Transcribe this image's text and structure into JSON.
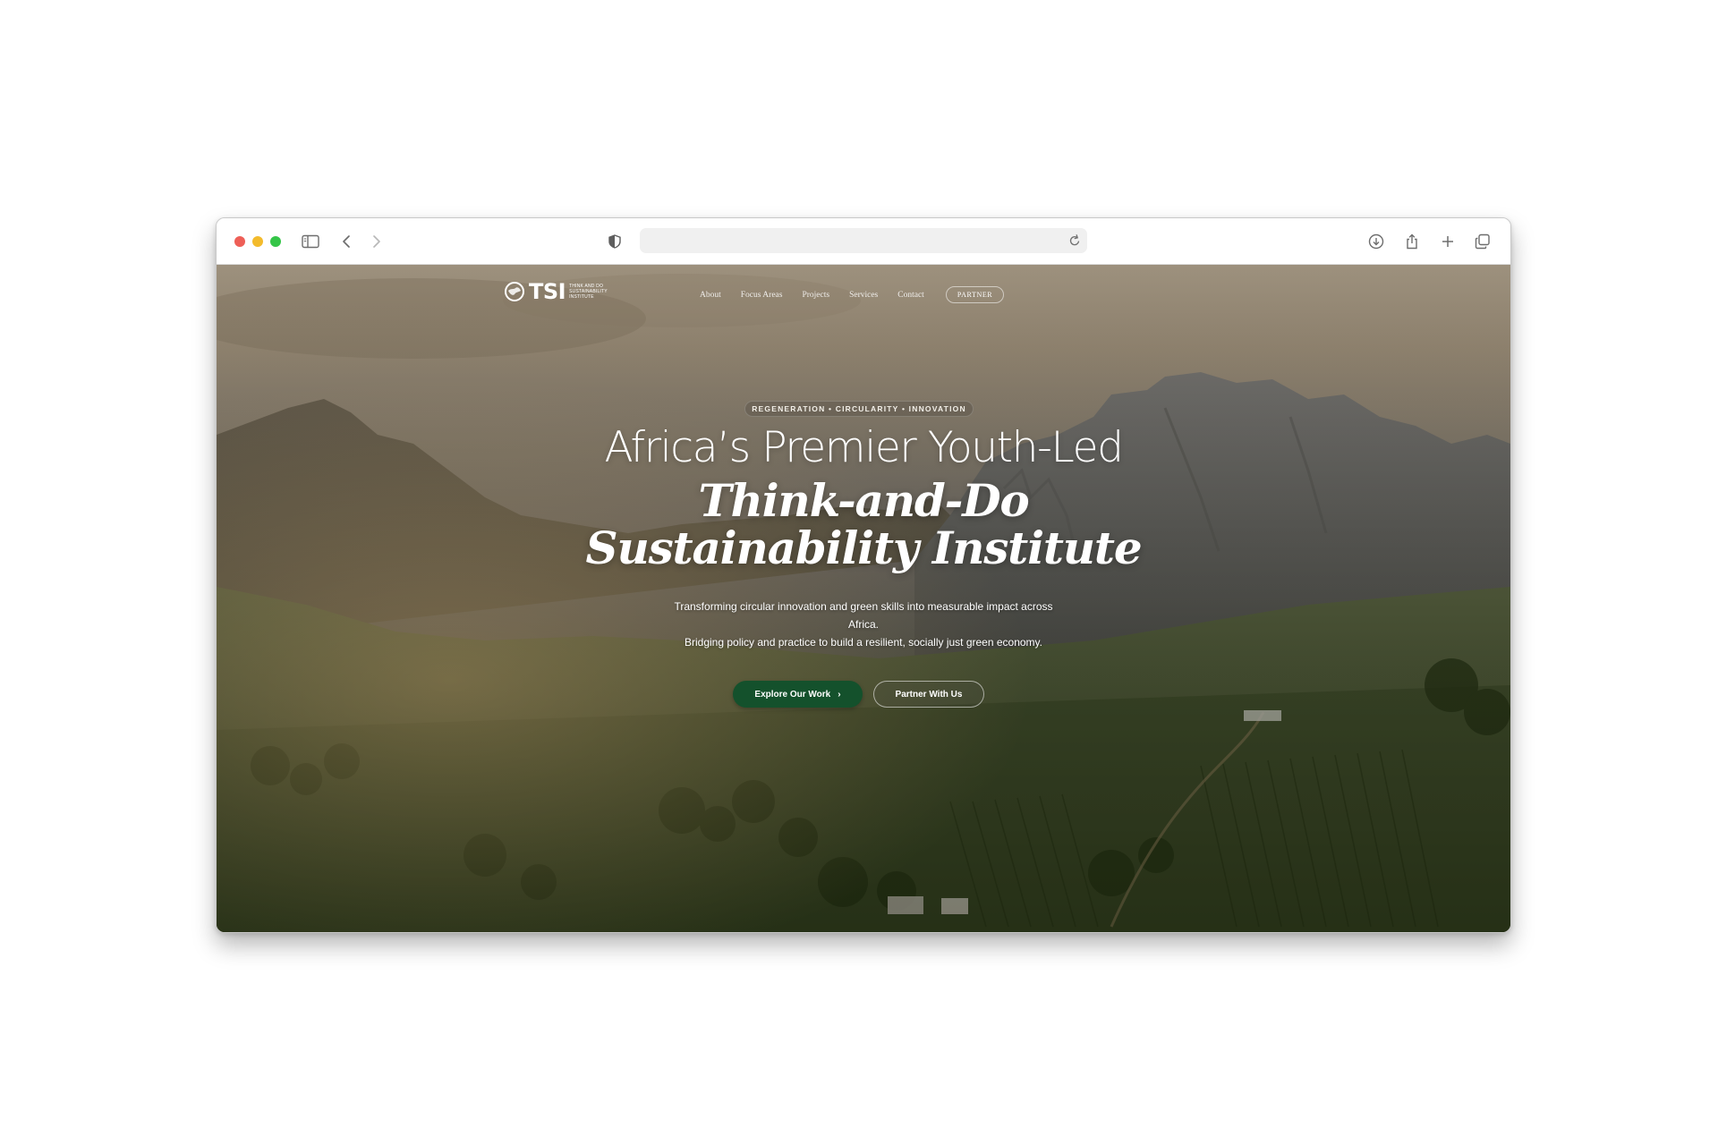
{
  "browser": {
    "icons": [
      "sidebar-icon",
      "back-icon",
      "forward-icon",
      "shield-icon",
      "reload-icon",
      "download-icon",
      "share-icon",
      "new-tab-icon",
      "tabs-overview-icon"
    ],
    "address_value": ""
  },
  "site": {
    "logo": {
      "wordmark": "TSI",
      "subtitle_line1": "THINK AND DO",
      "subtitle_line2": "SUSTAINABILITY INSTITUTE"
    },
    "nav": {
      "links": [
        "About",
        "Focus Areas",
        "Projects",
        "Services",
        "Contact"
      ],
      "cta": "PARTNER"
    },
    "hero": {
      "tagline": "REGENERATION • CIRCULARITY • INNOVATION",
      "headline_line1": "Africa’s Premier Youth-Led",
      "headline_line2": "Think-and-Do",
      "headline_line3": "Sustainability Institute",
      "description_line1": "Transforming circular innovation and green skills into measurable impact across",
      "description_line2": "Africa.",
      "description_line3": "Bridging policy and practice to build a resilient, socially just green economy.",
      "primary_button": "Explore Our Work",
      "primary_button_icon": "chevron-right-icon",
      "secondary_button": "Partner With Us"
    },
    "colors": {
      "primary_green": "#14512c",
      "text_white": "#ffffff"
    }
  }
}
